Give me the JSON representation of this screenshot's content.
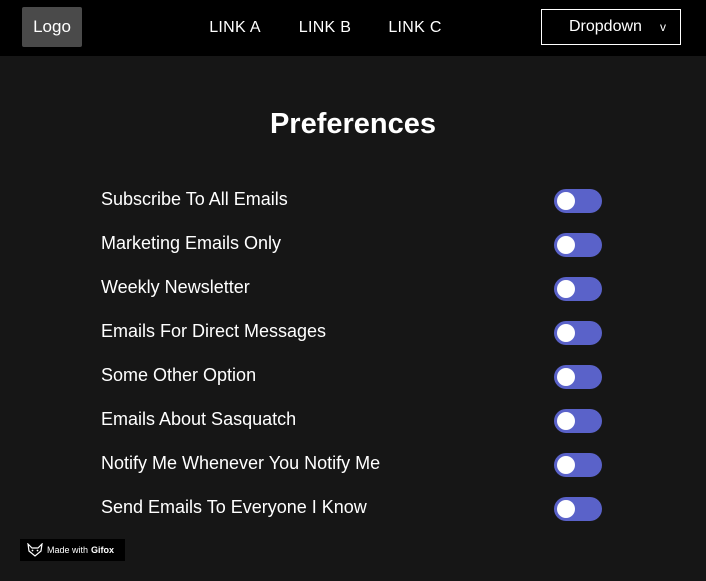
{
  "header": {
    "logo": "Logo",
    "links": [
      "LINK A",
      "LINK B",
      "LINK C"
    ],
    "dropdown": {
      "label": "Dropdown",
      "chevron": "v"
    }
  },
  "main": {
    "title": "Preferences",
    "preferences": [
      {
        "label": "Subscribe To All Emails",
        "enabled": false
      },
      {
        "label": "Marketing Emails Only",
        "enabled": false
      },
      {
        "label": "Weekly Newsletter",
        "enabled": false
      },
      {
        "label": "Emails For Direct Messages",
        "enabled": false
      },
      {
        "label": "Some Other Option",
        "enabled": false
      },
      {
        "label": "Emails About Sasquatch",
        "enabled": false
      },
      {
        "label": "Notify Me Whenever You Notify Me",
        "enabled": false
      },
      {
        "label": "Send Emails To Everyone I Know",
        "enabled": false
      }
    ]
  },
  "badge": {
    "prefix": "Made with",
    "brand": "Gifox",
    "icon": "fox-icon"
  },
  "colors": {
    "background": "#161616",
    "navbar": "#000000",
    "logo_bg": "#4a4a4a",
    "toggle_track": "#5a62c9",
    "toggle_knob": "#ffffff"
  }
}
